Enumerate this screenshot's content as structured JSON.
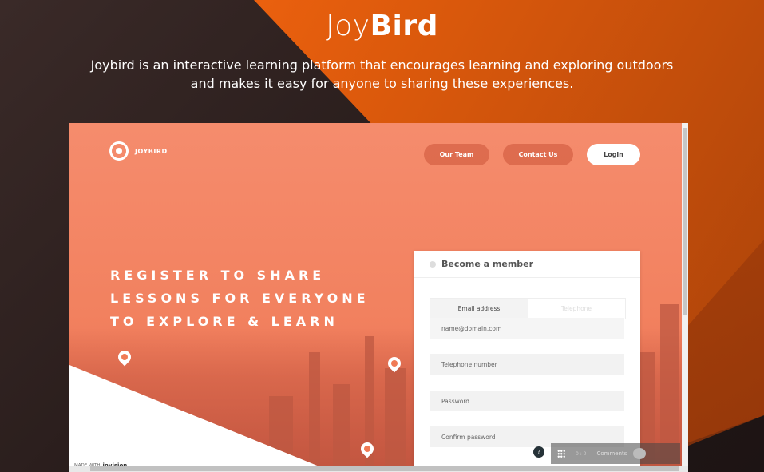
{
  "page": {
    "title_light": "Joy",
    "title_bold": "Bird",
    "subtitle": "Joybird is an interactive learning platform that encourages learning and exploring outdoors and makes it easy for anyone to sharing these experiences."
  },
  "mockup": {
    "logo_text": "JOYBIRD",
    "nav": {
      "our_team": "Our Team",
      "contact_us": "Contact Us",
      "login": "Login"
    },
    "headline": [
      "REGISTER TO SHARE",
      "LESSONS FOR EVERYONE",
      "TO EXPLORE & LEARN"
    ],
    "card": {
      "title": "Become a member",
      "tabs": [
        "Email address",
        "Telephone"
      ],
      "fields": [
        "name@domain.com",
        "Telephone number",
        "Password",
        "Confirm password"
      ]
    },
    "made_with_prefix": "MADE WITH",
    "made_with_brand": "invision",
    "toolbar": {
      "help": "?",
      "comments": "Comments",
      "counter": "0 : 0"
    }
  },
  "colors": {
    "accent_orange": "#ff6a10",
    "hero_coral": "#f58c6d",
    "dark_bg": "#2a1e1d"
  }
}
